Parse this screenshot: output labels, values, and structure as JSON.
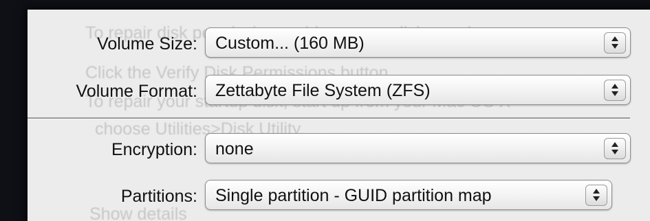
{
  "background_text": [
    "To repair disk permission problems on a disk or volume",
    "Click the Verify Disk Permissions button",
    "To repair your startup disk, start up from your Mac OS X",
    "choose Utilities>Disk Utility",
    "Show details"
  ],
  "fields": [
    {
      "label": "Volume Size:",
      "value": "Custom... (160 MB)"
    },
    {
      "label": "Volume Format:",
      "value": "Zettabyte File System (ZFS)"
    },
    {
      "label": "Encryption:",
      "value": "none"
    },
    {
      "label": "Partitions:",
      "value": "Single partition - GUID partition map"
    }
  ],
  "colors": {
    "panel": "#ececec",
    "backdrop": "#0e1015"
  },
  "icons": {
    "stepper": "up-down-arrows-icon"
  }
}
